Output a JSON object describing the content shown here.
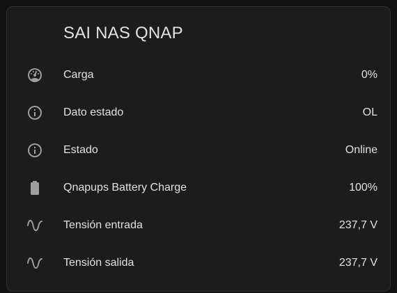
{
  "card": {
    "title": "SAI NAS QNAP",
    "icon_color": "#9e9e9e",
    "text_color": "#e1e1e1",
    "background_color": "#1c1c1c",
    "entities": [
      {
        "icon": "gauge-icon",
        "label": "Carga",
        "value": "0%"
      },
      {
        "icon": "info-icon",
        "label": "Dato estado",
        "value": "OL"
      },
      {
        "icon": "info-icon",
        "label": "Estado",
        "value": "Online"
      },
      {
        "icon": "battery-icon",
        "label": "Qnapups Battery Charge",
        "value": "100%"
      },
      {
        "icon": "sine-wave-icon",
        "label": "Tensión entrada",
        "value": "237,7 V"
      },
      {
        "icon": "sine-wave-icon",
        "label": "Tensión salida",
        "value": "237,7 V"
      }
    ]
  }
}
